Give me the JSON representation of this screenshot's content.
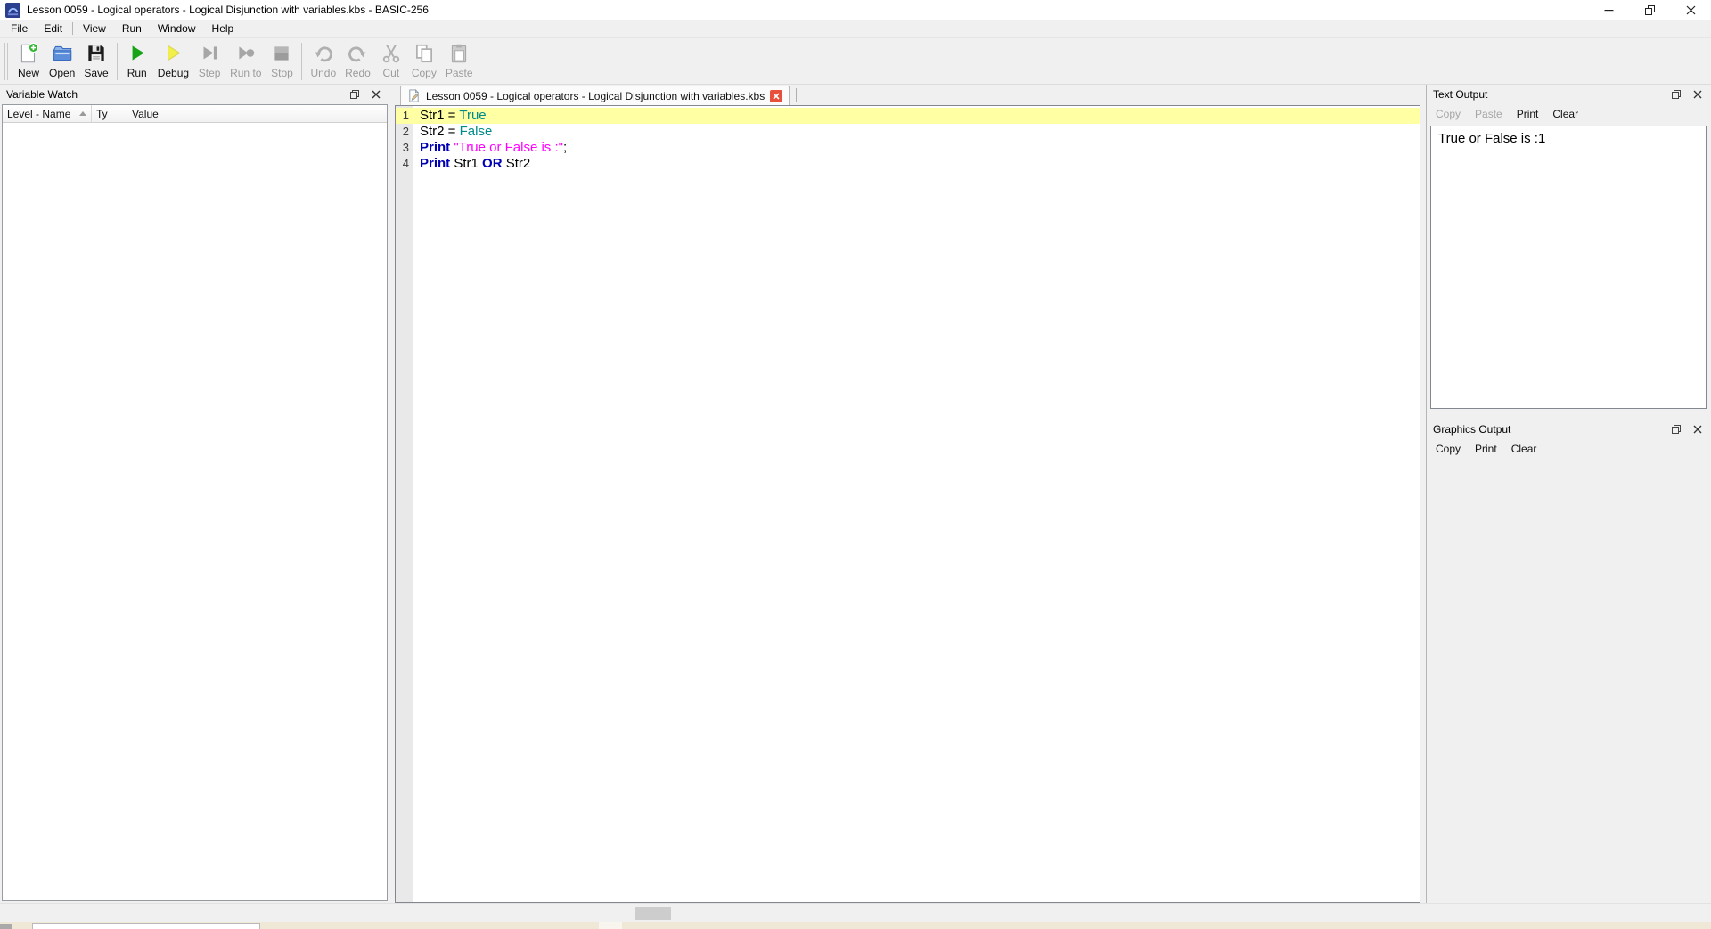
{
  "window": {
    "title": "Lesson 0059 - Logical operators - Logical Disjunction with variables.kbs - BASIC-256"
  },
  "menu": {
    "items": [
      "File",
      "Edit",
      "View",
      "Run",
      "Window",
      "Help"
    ],
    "separator_after_index": 1
  },
  "toolbar": {
    "groups": [
      [
        {
          "label": "New",
          "icon": "new-icon",
          "enabled": true
        },
        {
          "label": "Open",
          "icon": "open-icon",
          "enabled": true
        },
        {
          "label": "Save",
          "icon": "save-icon",
          "enabled": true
        }
      ],
      [
        {
          "label": "Run",
          "icon": "run-icon",
          "enabled": true
        },
        {
          "label": "Debug",
          "icon": "debug-icon",
          "enabled": true
        },
        {
          "label": "Step",
          "icon": "step-icon",
          "enabled": false
        },
        {
          "label": "Run to",
          "icon": "run-to-icon",
          "enabled": false
        },
        {
          "label": "Stop",
          "icon": "stop-icon",
          "enabled": false
        }
      ],
      [
        {
          "label": "Undo",
          "icon": "undo-icon",
          "enabled": false
        },
        {
          "label": "Redo",
          "icon": "redo-icon",
          "enabled": false
        },
        {
          "label": "Cut",
          "icon": "cut-icon",
          "enabled": false
        },
        {
          "label": "Copy",
          "icon": "copy-icon",
          "enabled": false
        },
        {
          "label": "Paste",
          "icon": "paste-icon",
          "enabled": false
        }
      ]
    ]
  },
  "variable_watch": {
    "title": "Variable Watch",
    "columns": [
      {
        "label": "Level - Name",
        "sorted": true
      },
      {
        "label": "Ty",
        "sorted": false
      },
      {
        "label": "Value",
        "sorted": false
      }
    ],
    "rows": []
  },
  "editor": {
    "tab": {
      "label": "Lesson 0059 - Logical operators - Logical Disjunction with variables.kbs"
    },
    "lines": [
      {
        "num": "1",
        "highlight": true,
        "segments": [
          {
            "text": "Str1 = ",
            "type": "plain"
          },
          {
            "text": "True",
            "type": "constant"
          }
        ]
      },
      {
        "num": "2",
        "highlight": false,
        "segments": [
          {
            "text": "Str2 = ",
            "type": "plain"
          },
          {
            "text": "False",
            "type": "constant"
          }
        ]
      },
      {
        "num": "3",
        "highlight": false,
        "segments": [
          {
            "text": "Print",
            "type": "keyword"
          },
          {
            "text": " ",
            "type": "plain"
          },
          {
            "text": "\"True or False is :\"",
            "type": "string"
          },
          {
            "text": ";",
            "type": "plain"
          }
        ]
      },
      {
        "num": "4",
        "highlight": false,
        "segments": [
          {
            "text": "Print",
            "type": "keyword"
          },
          {
            "text": " Str1 ",
            "type": "plain"
          },
          {
            "text": "OR",
            "type": "keyword"
          },
          {
            "text": " Str2",
            "type": "plain"
          }
        ]
      }
    ]
  },
  "text_output": {
    "title": "Text Output",
    "buttons": [
      {
        "label": "Copy",
        "enabled": false
      },
      {
        "label": "Paste",
        "enabled": false
      },
      {
        "label": "Print",
        "enabled": true
      },
      {
        "label": "Clear",
        "enabled": true
      }
    ],
    "content": "True or False is :1"
  },
  "graphics_output": {
    "title": "Graphics Output",
    "buttons": [
      {
        "label": "Copy",
        "enabled": true
      },
      {
        "label": "Print",
        "enabled": true
      },
      {
        "label": "Clear",
        "enabled": true
      }
    ]
  },
  "colors": {
    "run_green": "#17a317",
    "debug_yellow": "#f2ef4a",
    "keyword": "#0000b4",
    "constant": "#008b8b",
    "string": "#ff00ff",
    "line_highlight": "#ffffa4",
    "tab_close_red": "#e8503c",
    "title_bar": "#ffffff",
    "chrome": "#f0f0f0"
  }
}
